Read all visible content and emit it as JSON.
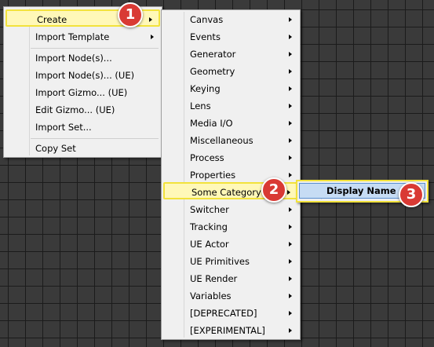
{
  "context_menu": {
    "items": [
      {
        "label": "Create",
        "submenu": true
      },
      {
        "label": "Import Template",
        "submenu": true
      },
      {
        "label": "Import Node(s)..."
      },
      {
        "label": "Import Node(s)... (UE)"
      },
      {
        "label": "Import Gizmo... (UE)"
      },
      {
        "label": "Edit Gizmo... (UE)"
      },
      {
        "label": "Import Set..."
      },
      {
        "label": "Copy Set"
      }
    ]
  },
  "create_submenu": {
    "items": [
      {
        "label": "Canvas"
      },
      {
        "label": "Events"
      },
      {
        "label": "Generator"
      },
      {
        "label": "Geometry"
      },
      {
        "label": "Keying"
      },
      {
        "label": "Lens"
      },
      {
        "label": "Media I/O"
      },
      {
        "label": "Miscellaneous"
      },
      {
        "label": "Process"
      },
      {
        "label": "Properties"
      },
      {
        "label": "Some Category"
      },
      {
        "label": "Switcher"
      },
      {
        "label": "Tracking"
      },
      {
        "label": "UE Actor"
      },
      {
        "label": "UE Primitives"
      },
      {
        "label": "UE Render"
      },
      {
        "label": "Variables"
      },
      {
        "label": "[DEPRECATED]"
      },
      {
        "label": "[EXPERIMENTAL]"
      }
    ]
  },
  "category_submenu": {
    "items": [
      {
        "label": "Display Name"
      }
    ]
  },
  "callouts": [
    "1",
    "2",
    "3"
  ],
  "colors": {
    "highlight_fill": "#fff8b8",
    "highlight_border": "#f2e23c",
    "badge": "#d93a34",
    "selection": "#c6dcf4",
    "background": "#3a3a3a"
  }
}
